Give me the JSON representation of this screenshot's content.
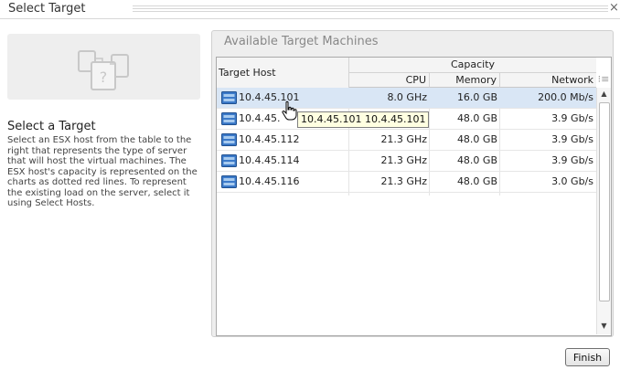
{
  "dialog": {
    "title": "Select Target",
    "close_glyph": "×"
  },
  "left": {
    "icon": "server-placeholder-icon",
    "heading": "Select a Target",
    "description": "Select an ESX host from the table to the right that represents the type of server that will host the virtual machines. The ESX host's capacity is represented on the charts as dotted red lines. To represent the existing load on the server, select it using Select Hosts."
  },
  "panel": {
    "title": "Available Target Machines"
  },
  "table": {
    "host_header": "Target Host",
    "group_header": "Capacity",
    "columns": [
      "CPU",
      "Memory",
      "Network"
    ],
    "rows": [
      {
        "host": "10.4.45.101",
        "cpu": "8.0 GHz",
        "memory": "16.0 GB",
        "network": "200.0 Mb/s",
        "selected": true
      },
      {
        "host": "10.4.45.",
        "cpu": "",
        "memory": "48.0 GB",
        "network": "3.9 Gb/s",
        "selected": false
      },
      {
        "host": "10.4.45.112",
        "cpu": "21.3 GHz",
        "memory": "48.0 GB",
        "network": "3.9 Gb/s",
        "selected": false
      },
      {
        "host": "10.4.45.114",
        "cpu": "21.3 GHz",
        "memory": "48.0 GB",
        "network": "3.9 Gb/s",
        "selected": false
      },
      {
        "host": "10.4.45.116",
        "cpu": "21.3 GHz",
        "memory": "48.0 GB",
        "network": "3.0 Gb/s",
        "selected": false
      }
    ],
    "host_icon": "server-icon",
    "column_picker_glyph": "⁝≡"
  },
  "tooltip": {
    "text": "10.4.45.101 10.4.45.101"
  },
  "cursor": {
    "icon": "hand-pointer-icon"
  },
  "buttons": {
    "finish": "Finish"
  },
  "colors": {
    "selected_row": "#d9e6f5",
    "panel_bg": "#eeeeee",
    "tooltip_bg": "#ffffe1",
    "host_icon_blue": "#3c7ac9"
  }
}
